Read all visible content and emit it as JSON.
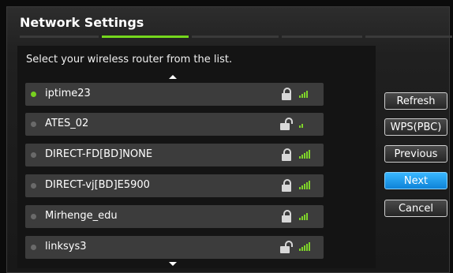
{
  "window": {
    "title": "Network Settings"
  },
  "instruction": "Select your wireless router from the list.",
  "networks": [
    {
      "name": "iptime23",
      "selected": true,
      "lock": "locked",
      "signal_bars": 4
    },
    {
      "name": "ATES_02",
      "selected": false,
      "lock": "unlocked",
      "signal_bars": 2
    },
    {
      "name": "DIRECT-FD[BD]NONE",
      "selected": false,
      "lock": "locked",
      "signal_bars": 5
    },
    {
      "name": "DIRECT-vj[BD]E5900",
      "selected": false,
      "lock": "locked",
      "signal_bars": 5
    },
    {
      "name": "Mirhenge_edu",
      "selected": false,
      "lock": "locked",
      "signal_bars": 4
    },
    {
      "name": "linksys3",
      "selected": false,
      "lock": "unlocked",
      "signal_bars": 5
    }
  ],
  "buttons": {
    "refresh": "Refresh",
    "wps": "WPS(PBC)",
    "previous": "Previous",
    "next": "Next",
    "cancel": "Cancel"
  },
  "colors": {
    "accent_green": "#77d11f",
    "focus_blue": "#1a9af0",
    "signal_green": "#7fd42a"
  }
}
